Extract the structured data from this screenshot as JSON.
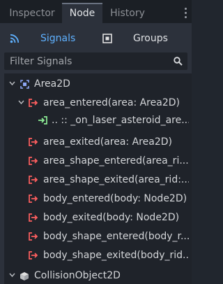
{
  "tabs": [
    {
      "label": "Inspector"
    },
    {
      "label": "Node"
    },
    {
      "label": "History"
    }
  ],
  "node_panel": {
    "signals_label": "Signals",
    "groups_label": "Groups",
    "filter_placeholder": "Filter Signals"
  },
  "tree": {
    "area2d": "Area2D",
    "area_entered": "area_entered(area: Area2D)",
    "connection": ".. :: _on_laser_asteroid_are...",
    "area_exited": "area_exited(area: Area2D)",
    "area_shape_entered": "area_shape_entered(area_ri...",
    "area_shape_exited": "area_shape_exited(area_rid:...",
    "body_entered": "body_entered(body: Node2D)",
    "body_exited": "body_exited(body: Node2D)",
    "body_shape_entered": "body_shape_entered(body_r...",
    "body_shape_exited": "body_shape_exited(body_rid...",
    "collision_object": "CollisionObject2D"
  },
  "colors": {
    "accent": "#5fb1ff",
    "signal_icon": "#ff5f5f",
    "connection_icon": "#8eef97",
    "node_icon": "#8da5f3"
  }
}
